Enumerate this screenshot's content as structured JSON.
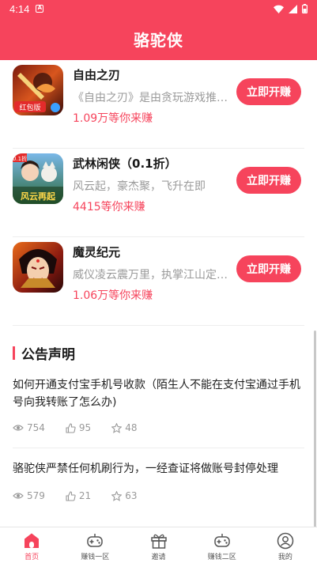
{
  "status_bar": {
    "time": "4:14",
    "indicator": "A"
  },
  "header": {
    "title": "骆驼侠"
  },
  "games": [
    {
      "title": "自由之刃",
      "desc": "《自由之刃》是由贪玩游戏推出的",
      "earn": "1.09万等你来赚",
      "button": "立即开赚",
      "badge": "红包版",
      "icon": "game-icon-ziyouzhiren"
    },
    {
      "title": "武林闲侠（0.1折）",
      "desc": "风云起，豪杰聚，飞升在即",
      "earn": "4415等你来赚",
      "button": "立即开赚",
      "badge": "风云再起",
      "corner": "0.1折",
      "icon": "game-icon-wulinxianxia"
    },
    {
      "title": "魔灵纪元",
      "desc": "威仪凌云震万里，执掌江山定乾坤",
      "earn": "1.06万等你来赚",
      "button": "立即开赚",
      "icon": "game-icon-molingjiyuan"
    }
  ],
  "notice": {
    "heading": "公告声明",
    "items": [
      {
        "title": "如何开通支付宝手机号收款（陌生人不能在支付宝通过手机号向我转账了怎么办)",
        "views": "754",
        "likes": "95",
        "stars": "48"
      },
      {
        "title": "骆驼侠严禁任何机刷行为，一经查证将做账号封停处理",
        "views": "579",
        "likes": "21",
        "stars": "63"
      }
    ]
  },
  "tabs": [
    {
      "label": "首页",
      "icon": "home-icon",
      "active": true
    },
    {
      "label": "赚钱一区",
      "icon": "gamepad-icon",
      "active": false
    },
    {
      "label": "邀请",
      "icon": "gift-icon",
      "active": false
    },
    {
      "label": "赚钱二区",
      "icon": "gamepad-icon",
      "active": false
    },
    {
      "label": "我的",
      "icon": "user-icon",
      "active": false
    }
  ],
  "colors": {
    "brand": "#f6445c",
    "muted": "#9a9a9a"
  }
}
